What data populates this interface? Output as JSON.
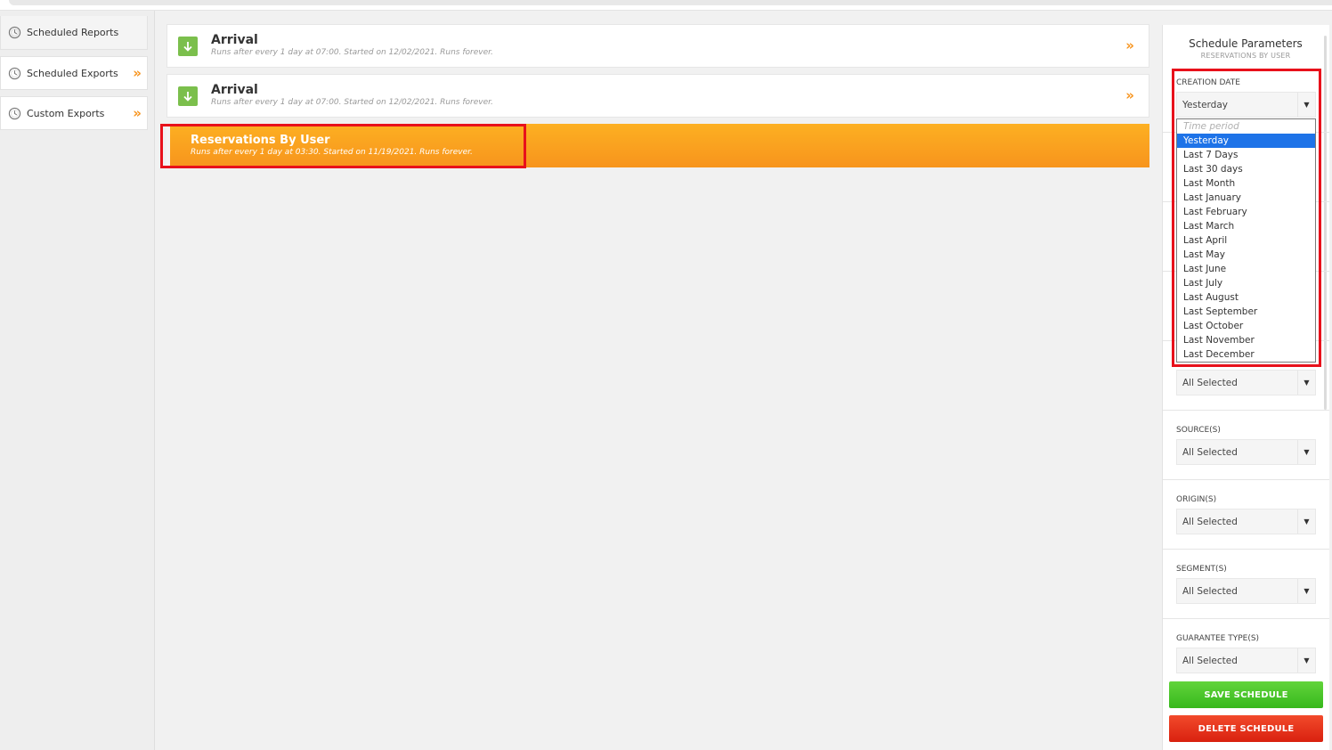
{
  "sidebar": {
    "items": [
      {
        "label": "Scheduled Reports",
        "icon": "clock-icon",
        "has_chevron": false
      },
      {
        "label": "Scheduled Exports",
        "icon": "clock-icon",
        "has_chevron": true
      },
      {
        "label": "Custom Exports",
        "icon": "clock-icon",
        "has_chevron": true
      }
    ],
    "chevron_glyph": "»"
  },
  "reports": [
    {
      "title": "Arrival",
      "subtitle": "Runs after every 1 day at 07:00. Started on 12/02/2021. Runs forever."
    },
    {
      "title": "Arrival",
      "subtitle": "Runs after every 1 day at 07:00. Started on 12/02/2021. Runs forever."
    }
  ],
  "active_report": {
    "title": "Reservations By User",
    "subtitle": "Runs after every 1 day at 03:30. Started on 11/19/2021. Runs forever."
  },
  "panel": {
    "title": "Schedule Parameters",
    "subtitle": "RESERVATIONS BY USER",
    "creation_date": {
      "label": "CREATION DATE",
      "value": "Yesterday",
      "options": [
        "Time period",
        "Yesterday",
        "Last 7 Days",
        "Last 30 days",
        "Last Month",
        "Last January",
        "Last February",
        "Last March",
        "Last April",
        "Last May",
        "Last June",
        "Last July",
        "Last August",
        "Last September",
        "Last October",
        "Last November",
        "Last December"
      ],
      "selected_index": 1
    },
    "fields": [
      {
        "label": "",
        "value": "All Selected"
      },
      {
        "label": "SOURCE(S)",
        "value": "All Selected"
      },
      {
        "label": "ORIGIN(S)",
        "value": "All Selected"
      },
      {
        "label": "SEGMENT(S)",
        "value": "All Selected"
      },
      {
        "label": "GUARANTEE TYPE(S)",
        "value": "All Selected"
      }
    ],
    "save_label": "SAVE SCHEDULE",
    "delete_label": "DELETE SCHEDULE"
  },
  "colors": {
    "accent_orange": "#f7941d",
    "save_green": "#36b81c",
    "delete_red": "#d9210f",
    "highlight_red": "#e8111b",
    "selection_blue": "#1e73e8"
  }
}
